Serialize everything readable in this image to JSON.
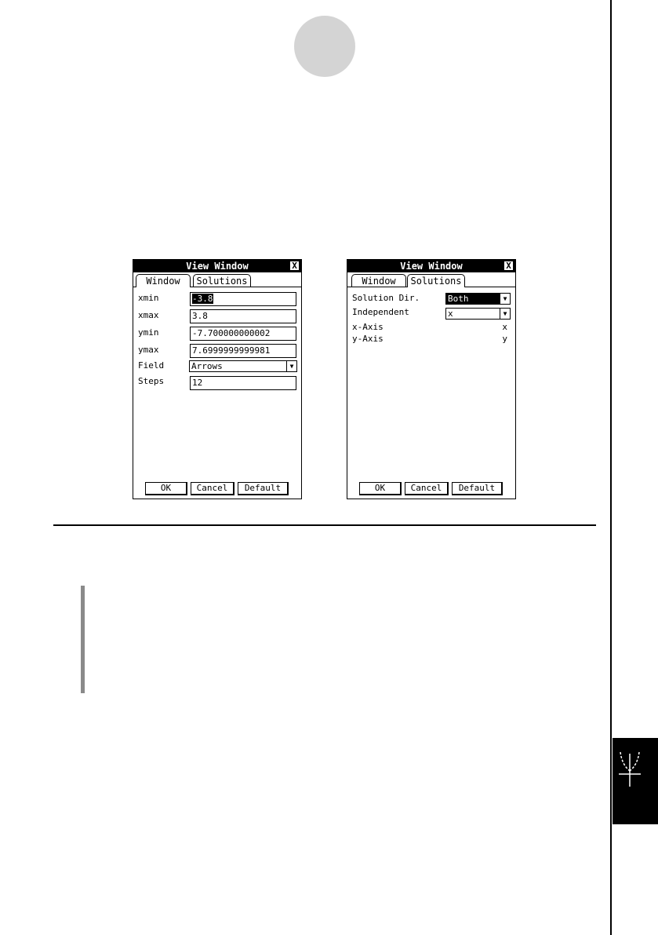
{
  "dialog_left": {
    "title": "View Window",
    "close": "X",
    "tabs": [
      "Window",
      "Solutions"
    ],
    "fields": [
      {
        "label": "xmin",
        "value": "-3.8"
      },
      {
        "label": "xmax",
        "value": "3.8"
      },
      {
        "label": "ymin",
        "value": "-7.700000000002"
      },
      {
        "label": "ymax",
        "value": "7.6999999999981"
      },
      {
        "label": "Field",
        "value": "Arrows"
      },
      {
        "label": "Steps",
        "value": "12"
      }
    ],
    "buttons": [
      "OK",
      "Cancel",
      "Default"
    ]
  },
  "dialog_right": {
    "title": "View Window",
    "close": "X",
    "tabs": [
      "Window",
      "Solutions"
    ],
    "solution_dir": {
      "label": "Solution Dir.",
      "value": "Both"
    },
    "independent": {
      "label": "Independent",
      "value": "x"
    },
    "x_axis": {
      "label": "x-Axis",
      "value": "x"
    },
    "y_axis": {
      "label": "y-Axis",
      "value": "y"
    },
    "buttons": [
      "OK",
      "Cancel",
      "Default"
    ]
  }
}
